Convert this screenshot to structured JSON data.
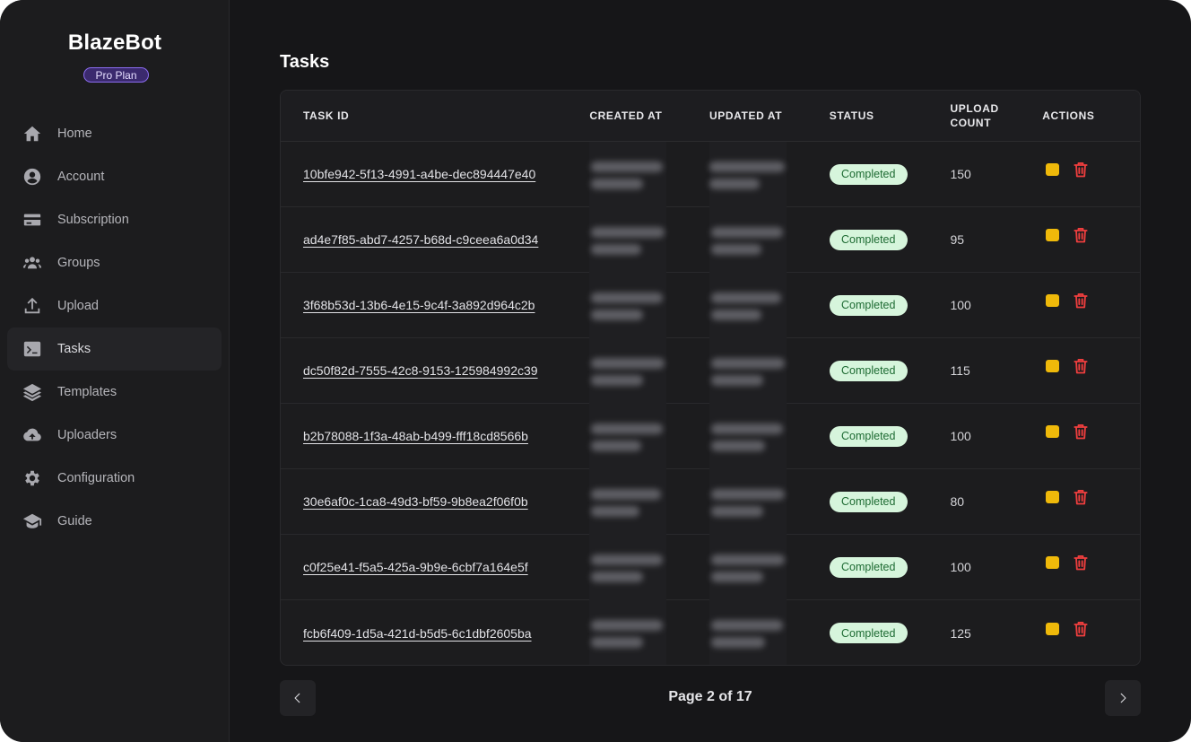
{
  "app": {
    "brand": "BlazeBot",
    "plan": "Pro Plan"
  },
  "sidebar": {
    "items": [
      {
        "label": "Home",
        "icon": "home-icon",
        "active": false
      },
      {
        "label": "Account",
        "icon": "account-icon",
        "active": false
      },
      {
        "label": "Subscription",
        "icon": "credit-card-icon",
        "active": false
      },
      {
        "label": "Groups",
        "icon": "users-icon",
        "active": false
      },
      {
        "label": "Upload",
        "icon": "upload-icon",
        "active": false
      },
      {
        "label": "Tasks",
        "icon": "terminal-icon",
        "active": true
      },
      {
        "label": "Templates",
        "icon": "layers-icon",
        "active": false
      },
      {
        "label": "Uploaders",
        "icon": "cloud-upload-icon",
        "active": false
      },
      {
        "label": "Configuration",
        "icon": "gear-icon",
        "active": false
      },
      {
        "label": "Guide",
        "icon": "graduation-cap-icon",
        "active": false
      }
    ]
  },
  "main": {
    "title": "Tasks",
    "table": {
      "columns": {
        "task_id": "TASK ID",
        "created_at": "CREATED AT",
        "updated_at": "UPDATED AT",
        "status": "STATUS",
        "upload_count": "UPLOAD COUNT",
        "actions": "ACTIONS"
      },
      "rows": [
        {
          "task_id": "10bfe942-5f13-4991-a4be-dec894447e40",
          "status": "Completed",
          "upload_count": "150"
        },
        {
          "task_id": "ad4e7f85-abd7-4257-b68d-c9ceea6a0d34",
          "status": "Completed",
          "upload_count": "95"
        },
        {
          "task_id": "3f68b53d-13b6-4e15-9c4f-3a892d964c2b",
          "status": "Completed",
          "upload_count": "100"
        },
        {
          "task_id": "dc50f82d-7555-42c8-9153-125984992c39",
          "status": "Completed",
          "upload_count": "115"
        },
        {
          "task_id": "b2b78088-1f3a-48ab-b499-fff18cd8566b",
          "status": "Completed",
          "upload_count": "100"
        },
        {
          "task_id": "30e6af0c-1ca8-49d3-bf59-9b8ea2f06f0b",
          "status": "Completed",
          "upload_count": "80"
        },
        {
          "task_id": "c0f25e41-f5a5-425a-9b9e-6cbf7a164e5f",
          "status": "Completed",
          "upload_count": "100"
        },
        {
          "task_id": "fcb6f409-1d5a-421d-b5d5-6c1dbf2605ba",
          "status": "Completed",
          "upload_count": "125"
        }
      ]
    },
    "pagination": {
      "label": "Page 2 of 17"
    }
  },
  "colors": {
    "background": "#161618",
    "sidebar": "#1c1c1e",
    "plan_badge": "#3b2a6e",
    "status_completed_bg": "#d6f5dc",
    "edit_action": "#efb90a",
    "delete_action": "#f03e3e"
  }
}
